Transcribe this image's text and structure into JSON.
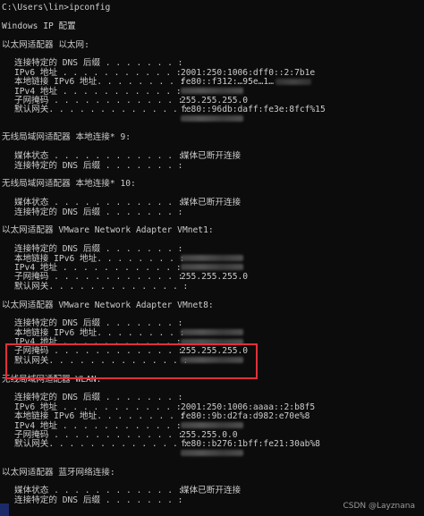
{
  "prompt": "C:\\Users\\lin>ipconfig",
  "heading": "Windows IP 配置",
  "adapters": [
    {
      "title": "以太网适配器 以太网:",
      "rows": [
        {
          "label": "连接特定的 DNS 后缀 . . . . . . . :",
          "value": ""
        },
        {
          "label": "IPv6 地址 . . . . . . . . . . . :",
          "value": "2001:250:1006:dff0::2:7b1e"
        },
        {
          "label": "本地链接 IPv6 地址. . . . . . . . :",
          "value": "fe80::f312:…95e…1…",
          "blur": true
        },
        {
          "label": "IPv4 地址 . . . . . . . . . . . :",
          "value": "",
          "blur": true
        },
        {
          "label": "子网掩码 . . . . . . . . . . . . :",
          "value": "255.255.255.0"
        },
        {
          "label": "默认网关. . . . . . . . . . . . . :",
          "value": "fe80::96db:daff:fe3e:8fcf%15"
        },
        {
          "label": "",
          "value": "",
          "blur": true
        }
      ]
    },
    {
      "title": "无线局域网适配器 本地连接* 9:",
      "rows": [
        {
          "label": "媒体状态 . . . . . . . . . . . . :",
          "value": "媒体已断开连接"
        },
        {
          "label": "连接特定的 DNS 后缀 . . . . . . . :",
          "value": ""
        }
      ]
    },
    {
      "title": "无线局域网适配器 本地连接* 10:",
      "rows": [
        {
          "label": "媒体状态 . . . . . . . . . . . . :",
          "value": "媒体已断开连接"
        },
        {
          "label": "连接特定的 DNS 后缀 . . . . . . . :",
          "value": ""
        }
      ]
    },
    {
      "title": "以太网适配器 VMware Network Adapter VMnet1:",
      "rows": [
        {
          "label": "连接特定的 DNS 后缀 . . . . . . . :",
          "value": ""
        },
        {
          "label": "本地链接 IPv6 地址. . . . . . . . :",
          "value": "",
          "blur": true
        },
        {
          "label": "IPv4 地址 . . . . . . . . . . . :",
          "value": "",
          "blur": true
        },
        {
          "label": "子网掩码 . . . . . . . . . . . . :",
          "value": "255.255.255.0"
        },
        {
          "label": "默认网关. . . . . . . . . . . . . :",
          "value": ""
        }
      ]
    },
    {
      "title": "以太网适配器 VMware Network Adapter VMnet8:",
      "rows": [
        {
          "label": "连接特定的 DNS 后缀 . . . . . . . :",
          "value": ""
        },
        {
          "label": "本地链接 IPv6 地址. . . . . . . . :",
          "value": "",
          "blur": true
        },
        {
          "label": "IPv4 地址 . . . . . . . . . . . :",
          "value": "",
          "blur": true
        },
        {
          "label": "子网掩码 . . . . . . . . . . . . :",
          "value": "255.255.255.0"
        },
        {
          "label": "默认网关. . . . . . . . . . . . . :",
          "value": "",
          "blur": true
        }
      ]
    },
    {
      "title": "无线局域网适配器 WLAN:",
      "rows": [
        {
          "label": "连接特定的 DNS 后缀 . . . . . . . :",
          "value": ""
        },
        {
          "label": "IPv6 地址 . . . . . . . . . . . :",
          "value": "2001:250:1006:aaaa::2:b8f5"
        },
        {
          "label": "本地链接 IPv6 地址. . . . . . . . :",
          "value": "fe80::9b:d2fa:d982:e70e%8"
        },
        {
          "label": "IPv4 地址 . . . . . . . . . . . :",
          "value": "",
          "blur": true
        },
        {
          "label": "子网掩码 . . . . . . . . . . . . :",
          "value": "255.255.0.0"
        },
        {
          "label": "默认网关. . . . . . . . . . . . . :",
          "value": "fe80::b276:1bff:fe21:30ab%8"
        },
        {
          "label": "",
          "value": "",
          "blur": true
        }
      ]
    },
    {
      "title": "以太网适配器 蓝牙网络连接:",
      "rows": [
        {
          "label": "媒体状态 . . . . . . . . . . . . :",
          "value": "媒体已断开连接"
        },
        {
          "label": "连接特定的 DNS 后缀 . . . . . . . :",
          "value": ""
        }
      ]
    }
  ],
  "watermark": "CSDN @Layznana",
  "colors": {
    "background": "#0c0c0c",
    "text": "#cccccc",
    "highlight": "#e0303a"
  }
}
